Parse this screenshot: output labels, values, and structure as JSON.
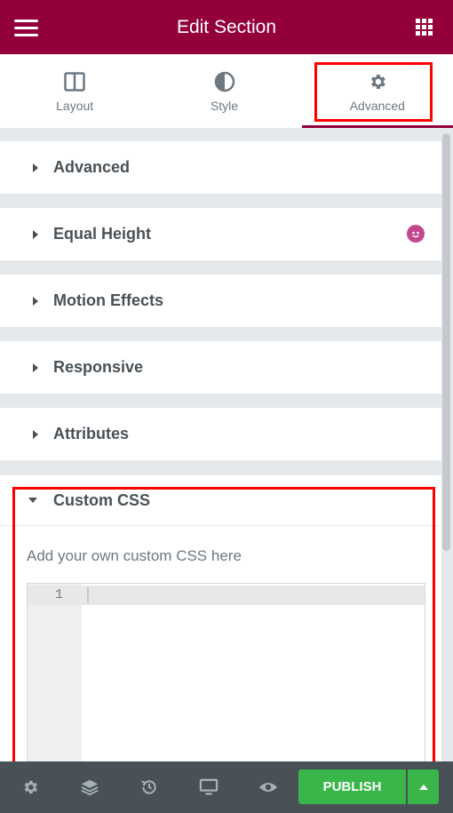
{
  "header": {
    "title": "Edit Section",
    "menu_icon": "hamburger-icon",
    "apps_icon": "grid-icon"
  },
  "tabs": [
    {
      "label": "Layout",
      "icon": "columns-icon"
    },
    {
      "label": "Style",
      "icon": "half-circle-icon"
    },
    {
      "label": "Advanced",
      "icon": "gear-icon",
      "active": true
    }
  ],
  "sections": [
    {
      "label": "Advanced"
    },
    {
      "label": "Equal Height",
      "badge_icon": "addon-badge-icon"
    },
    {
      "label": "Motion Effects"
    },
    {
      "label": "Responsive"
    },
    {
      "label": "Attributes"
    }
  ],
  "custom_css": {
    "label": "Custom CSS",
    "description": "Add your own custom CSS here",
    "line_number": "1",
    "code": ""
  },
  "footer": {
    "publish_label": "PUBLISH",
    "icons": [
      "settings-icon",
      "layers-icon",
      "history-icon",
      "responsive-icon",
      "preview-icon"
    ]
  },
  "colors": {
    "header_bg": "#93003c",
    "footer_bg": "#495157",
    "publish_bg": "#39b54a",
    "highlight": "#ff0000"
  }
}
